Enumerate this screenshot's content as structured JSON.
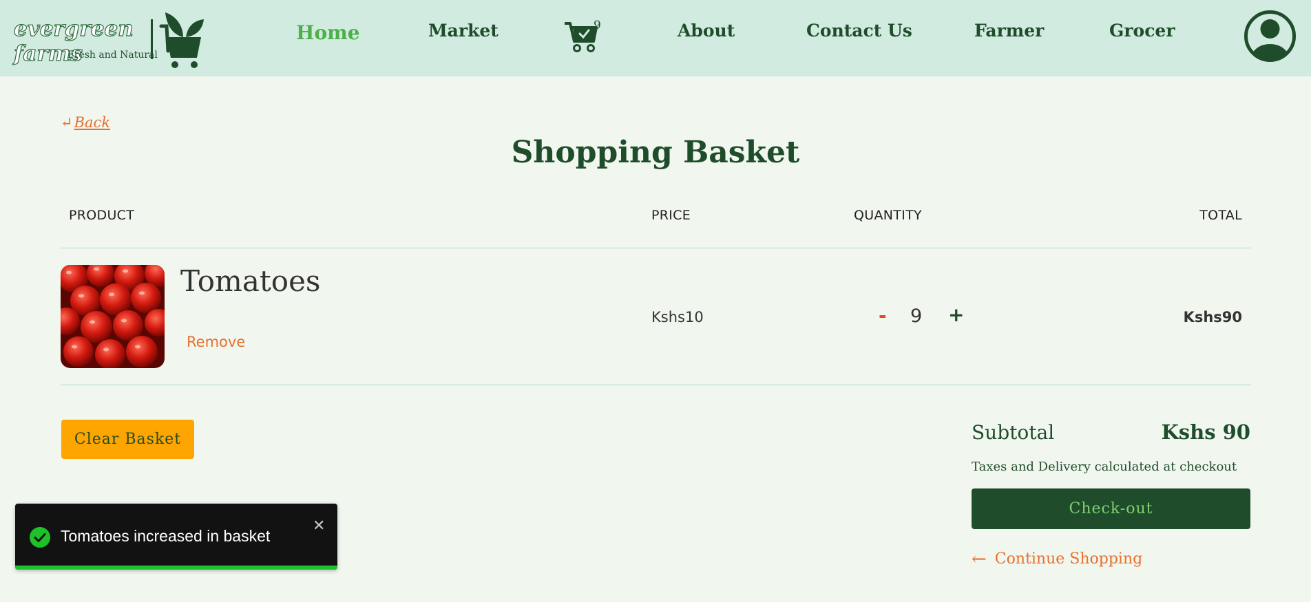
{
  "brand": {
    "name": "evergreen farms",
    "tagline": "Fresh and Natural"
  },
  "nav": {
    "home": "Home",
    "market": "Market",
    "cart_count": "9",
    "about": "About",
    "contact": "Contact Us",
    "farmer": "Farmer",
    "grocer": "Grocer",
    "active": "Home"
  },
  "page": {
    "back_label": "Back",
    "title": "Shopping Basket"
  },
  "table": {
    "headers": {
      "product": "PRODUCT",
      "price": "PRICE",
      "quantity": "QUANTITY",
      "total": "TOTAL"
    },
    "rows": [
      {
        "name": "Tomatoes",
        "remove_label": "Remove",
        "price": "Kshs10",
        "quantity": "9",
        "minus_label": "-",
        "plus_label": "+",
        "total": "Kshs90"
      }
    ]
  },
  "actions": {
    "clear_label": "Clear Basket"
  },
  "summary": {
    "subtotal_label": "Subtotal",
    "subtotal_value": "Kshs 90",
    "tax_note": "Taxes and Delivery calculated at checkout",
    "checkout_label": "Check-out",
    "continue_label": "Continue Shopping"
  },
  "toast": {
    "message": "Tomatoes increased in basket",
    "close_label": "✕",
    "progress": 1.0
  },
  "colors": {
    "header_bg": "#d1ebe0",
    "page_bg": "#f1f6ef",
    "primary_green": "#1f4d2b",
    "active_green": "#4db049",
    "accent_orange": "#e5712d",
    "clear_button": "#ffa500",
    "toast_bg": "#121212",
    "toast_progress": "#1fc12a"
  }
}
